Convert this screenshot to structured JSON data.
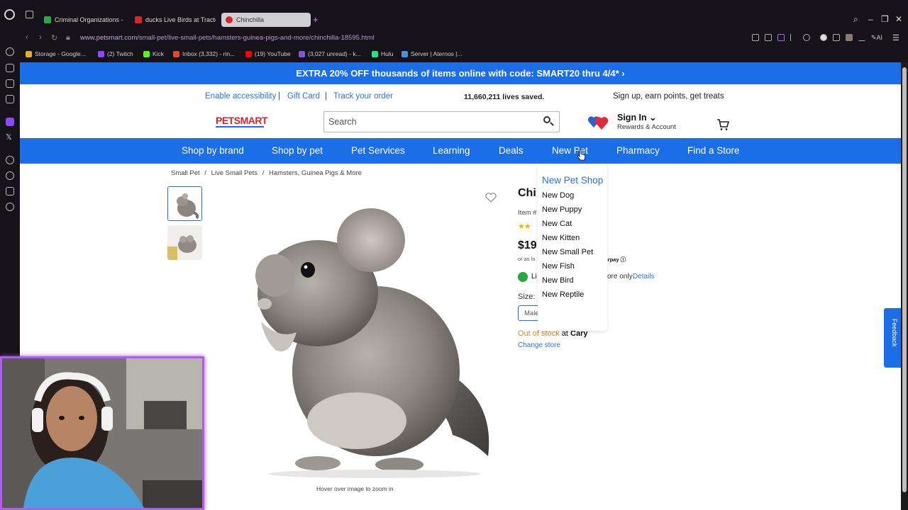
{
  "browser": {
    "tabs": [
      {
        "label": "Criminal Organizations - G",
        "favicon_color": "#2aa84a"
      },
      {
        "label": "ducks Live Birds at Tracto",
        "favicon_color": "#d8232a"
      },
      {
        "label": "Chinchilla",
        "favicon_color": "#d8232a"
      }
    ],
    "url_host": "www.petsmart.com",
    "url_path": "/small-pet/live-small-pets/hamsters-guinea-pigs-and-more/chinchilla-18595.html",
    "bookmarks": [
      {
        "label": "Storage - Google...",
        "color": "#e8b020"
      },
      {
        "label": "(2) Twitch",
        "color": "#9146ff"
      },
      {
        "label": "Kick",
        "color": "#53fc18"
      },
      {
        "label": "Inbox (3,332) - rin...",
        "color": "#ea4335"
      },
      {
        "label": "(19) YouTube",
        "color": "#ff0000"
      },
      {
        "label": "(3,027 unread) - k...",
        "color": "#7b5ad6"
      },
      {
        "label": "Hulu",
        "color": "#1ce783"
      },
      {
        "label": "Server | Aternos |...",
        "color": "#4a8fe0"
      }
    ],
    "ai_label": "AI"
  },
  "promo": {
    "text": "EXTRA 20% OFF thousands of items online with code: SMART20 thru 4/4* ›"
  },
  "utility": {
    "accessibility": "Enable accessibility",
    "sep": "|",
    "gift_card": "Gift Card",
    "track_order": "Track your order",
    "lives_saved": "11,660,211 lives saved.",
    "signup": "Sign up, earn points, get treats"
  },
  "header": {
    "logo_text": "PETSMART",
    "search_placeholder": "Search",
    "sign_in": "Sign In",
    "rewards": "Rewards & Account"
  },
  "nav": {
    "items": [
      "Shop by brand",
      "Shop by pet",
      "Pet Services",
      "Learning",
      "Deals",
      "New Pet",
      "Pharmacy",
      "Find a Store"
    ]
  },
  "breadcrumb": {
    "items": [
      "Small Pet",
      "/",
      "Live Small Pets",
      "/",
      "Hamsters, Guinea Pigs & More"
    ]
  },
  "product": {
    "title_partial": "Chi",
    "item_partial": "Item #",
    "price_partial": "$19",
    "or_as_partial": "or as lo",
    "afterpay_partial": "terpay ⓘ",
    "availability_partial": "Li",
    "store_only_partial": "ore only",
    "details_link": "Details",
    "size_label": "Size:",
    "size_option_partial": "Male",
    "out_of_stock": "Out of stock",
    "at": "at",
    "store": "Cary",
    "change_store": "Change store",
    "zoom_hint": "Hover over image to zoom in"
  },
  "dropdown": {
    "title": "New Pet Shop",
    "items": [
      "New Dog",
      "New Puppy",
      "New Cat",
      "New Kitten",
      "New Small Pet",
      "New Fish",
      "New Bird",
      "New Reptile"
    ]
  },
  "feedback": {
    "label": "Feedback"
  },
  "colors": {
    "brand_blue": "#1b6ee8",
    "link_blue": "#2b72d6",
    "petsmart_red": "#d8232a",
    "webcam_border": "#b15cf0"
  }
}
